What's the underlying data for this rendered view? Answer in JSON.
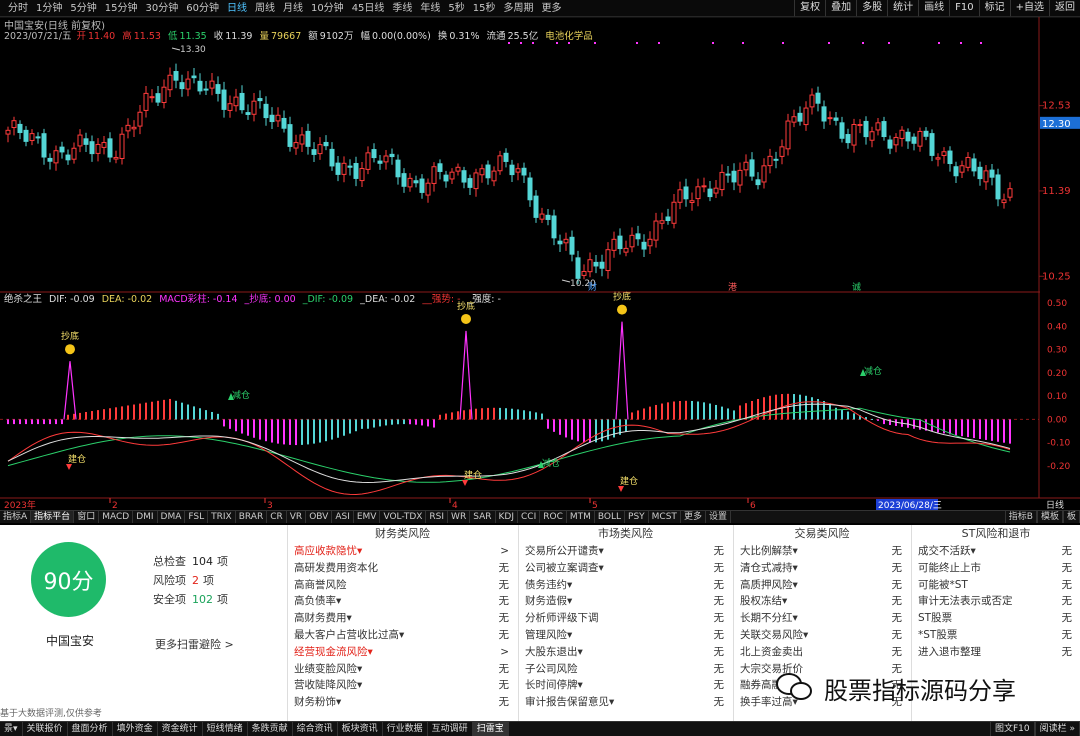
{
  "toolbar": {
    "periods": [
      "分时",
      "1分钟",
      "5分钟",
      "15分钟",
      "30分钟",
      "60分钟",
      "日线",
      "周线",
      "月线",
      "10分钟",
      "45日线",
      "季线",
      "年线",
      "5秒",
      "15秒",
      "多周期",
      "更多"
    ],
    "active_period": "日线",
    "right_tools": [
      "复权",
      "叠加",
      "多股",
      "统计",
      "画线",
      "F10",
      "标记",
      "+自选",
      "返回"
    ]
  },
  "quote": {
    "title": "中国宝安(日线 前复权)",
    "date": "2023/07/21/五",
    "open_label": "开",
    "open": "11.40",
    "high_label": "高",
    "high": "11.53",
    "low_label": "低",
    "low": "11.35",
    "close_label": "收",
    "close": "11.39",
    "vol_label": "量",
    "vol": "79667",
    "amount_label": "额",
    "amount": "9102万",
    "change_label": "幅",
    "change": "0.00(0.00%)",
    "turnover_label": "换",
    "turnover": "0.31%",
    "float_label": "流通",
    "float": "25.5亿",
    "sector": "电池化学品"
  },
  "price_axis": [
    "12.53",
    "12.30",
    "11.39",
    "10.25"
  ],
  "price_annotations": {
    "high": "13.30",
    "low": "10.20"
  },
  "event_markers": [
    "财",
    "港",
    "诚"
  ],
  "indicator": {
    "name": "绝杀之王",
    "dif": "DIF: -0.09",
    "dea": "DEA: -0.02",
    "macd": "MACD彩柱: -0.14",
    "chaodi": "_抄底: 0.00",
    "dif2": "_DIF: -0.09",
    "dea2": "_DEA: -0.02",
    "qiangshi": "__强势: -",
    "qiangdu": "_强度: -",
    "axis": [
      "0.50",
      "0.40",
      "0.30",
      "0.20",
      "0.10",
      "0.00",
      "-0.10",
      "-0.20"
    ],
    "labels": {
      "chaodi": "抄底",
      "chaodi_cut": "抄底",
      "jiancang": "建仓",
      "jianfang": "减仓"
    }
  },
  "date_axis": {
    "year": "2023年",
    "months": [
      "2",
      "3",
      "4",
      "5",
      "6"
    ],
    "cursor": "2023/06/28/三",
    "period": "日线"
  },
  "tabs": [
    "指标A",
    "指标平台",
    "窗口",
    "MACD",
    "DMI",
    "DMA",
    "FSL",
    "TRIX",
    "BRAR",
    "CR",
    "VR",
    "OBV",
    "ASI",
    "EMV",
    "VOL-TDX",
    "RSI",
    "WR",
    "SAR",
    "KDJ",
    "CCI",
    "ROC",
    "MTM",
    "BOLL",
    "PSY",
    "MCST",
    "更多",
    "设置"
  ],
  "tabs_active": "指标平台",
  "tabs_right": [
    "指标B",
    "模板",
    "板"
  ],
  "risk": {
    "score": "90分",
    "stock": "中国宝安",
    "total_label": "总检查",
    "total": "104",
    "total_unit": "项",
    "risk_label": "风险项",
    "risk_count": "2",
    "risk_unit": "项",
    "safe_label": "安全项",
    "safe": "102",
    "safe_unit": "项",
    "more": "更多扫雷避险 >",
    "disclaimer": "基于大数据评测,仅供参考",
    "columns": [
      {
        "title": "财务类风险",
        "rows": [
          {
            "label": "高应收款隐忧▾",
            "status": ">",
            "risk": true
          },
          {
            "label": "高研发费用资本化",
            "status": "无"
          },
          {
            "label": "高商誉风险",
            "status": "无"
          },
          {
            "label": "高负债率▾",
            "status": "无"
          },
          {
            "label": "高财务费用▾",
            "status": "无"
          },
          {
            "label": "最大客户占营收比过高▾",
            "status": "无"
          },
          {
            "label": "经营现金流风险▾",
            "status": ">",
            "risk": true
          },
          {
            "label": "业绩变脸风险▾",
            "status": "无"
          },
          {
            "label": "营收陡降风险▾",
            "status": "无"
          },
          {
            "label": "财务粉饰▾",
            "status": "无"
          }
        ]
      },
      {
        "title": "市场类风险",
        "rows": [
          {
            "label": "交易所公开谴责▾",
            "status": "无"
          },
          {
            "label": "公司被立案调查▾",
            "status": "无"
          },
          {
            "label": "债务违约▾",
            "status": "无"
          },
          {
            "label": "财务造假▾",
            "status": "无"
          },
          {
            "label": "分析师评级下调",
            "status": "无"
          },
          {
            "label": "管理风险▾",
            "status": "无"
          },
          {
            "label": "大股东退出▾",
            "status": "无"
          },
          {
            "label": "子公司风险",
            "status": "无"
          },
          {
            "label": "长时间停牌▾",
            "status": "无"
          },
          {
            "label": "审计报告保留意见▾",
            "status": "无"
          }
        ]
      },
      {
        "title": "交易类风险",
        "rows": [
          {
            "label": "大比例解禁▾",
            "status": "无"
          },
          {
            "label": "清仓式减持▾",
            "status": "无"
          },
          {
            "label": "高质押风险▾",
            "status": "无"
          },
          {
            "label": "股权冻结▾",
            "status": "无"
          },
          {
            "label": "长期不分红▾",
            "status": "无"
          },
          {
            "label": "关联交易风险▾",
            "status": "无"
          },
          {
            "label": "北上资金卖出",
            "status": "无"
          },
          {
            "label": "大宗交易折价",
            "status": "无"
          },
          {
            "label": "融券高融资",
            "status": "无"
          },
          {
            "label": "换手率过高▾",
            "status": "无"
          }
        ]
      },
      {
        "title": "ST风险和退市",
        "rows": [
          {
            "label": "成交不活跃▾",
            "status": "无"
          },
          {
            "label": "可能终止上市",
            "status": "无"
          },
          {
            "label": "可能被*ST",
            "status": "无"
          },
          {
            "label": "审计无法表示或否定",
            "status": "无"
          },
          {
            "label": "ST股票",
            "status": "无"
          },
          {
            "label": "*ST股票",
            "status": "无"
          },
          {
            "label": "进入退市整理",
            "status": "无"
          }
        ]
      }
    ]
  },
  "bottom": {
    "items": [
      "景▾",
      "关联报价",
      "盘面分析",
      "填外资金",
      "资金统计",
      "短线情绪",
      "条跌贡献",
      "综合资讯",
      "板块资讯",
      "行业数据",
      "互动调研",
      "扫雷宝"
    ],
    "active": "扫雷宝",
    "right": [
      "图文F10",
      "阅读栏 »"
    ]
  },
  "watermark": "股票指标源码分享",
  "colors": {
    "up": "#ff3b3b",
    "down": "#54d6d6",
    "magenta": "#ff34ff",
    "green": "#1fba6a",
    "accent": "#4fc3ff"
  }
}
